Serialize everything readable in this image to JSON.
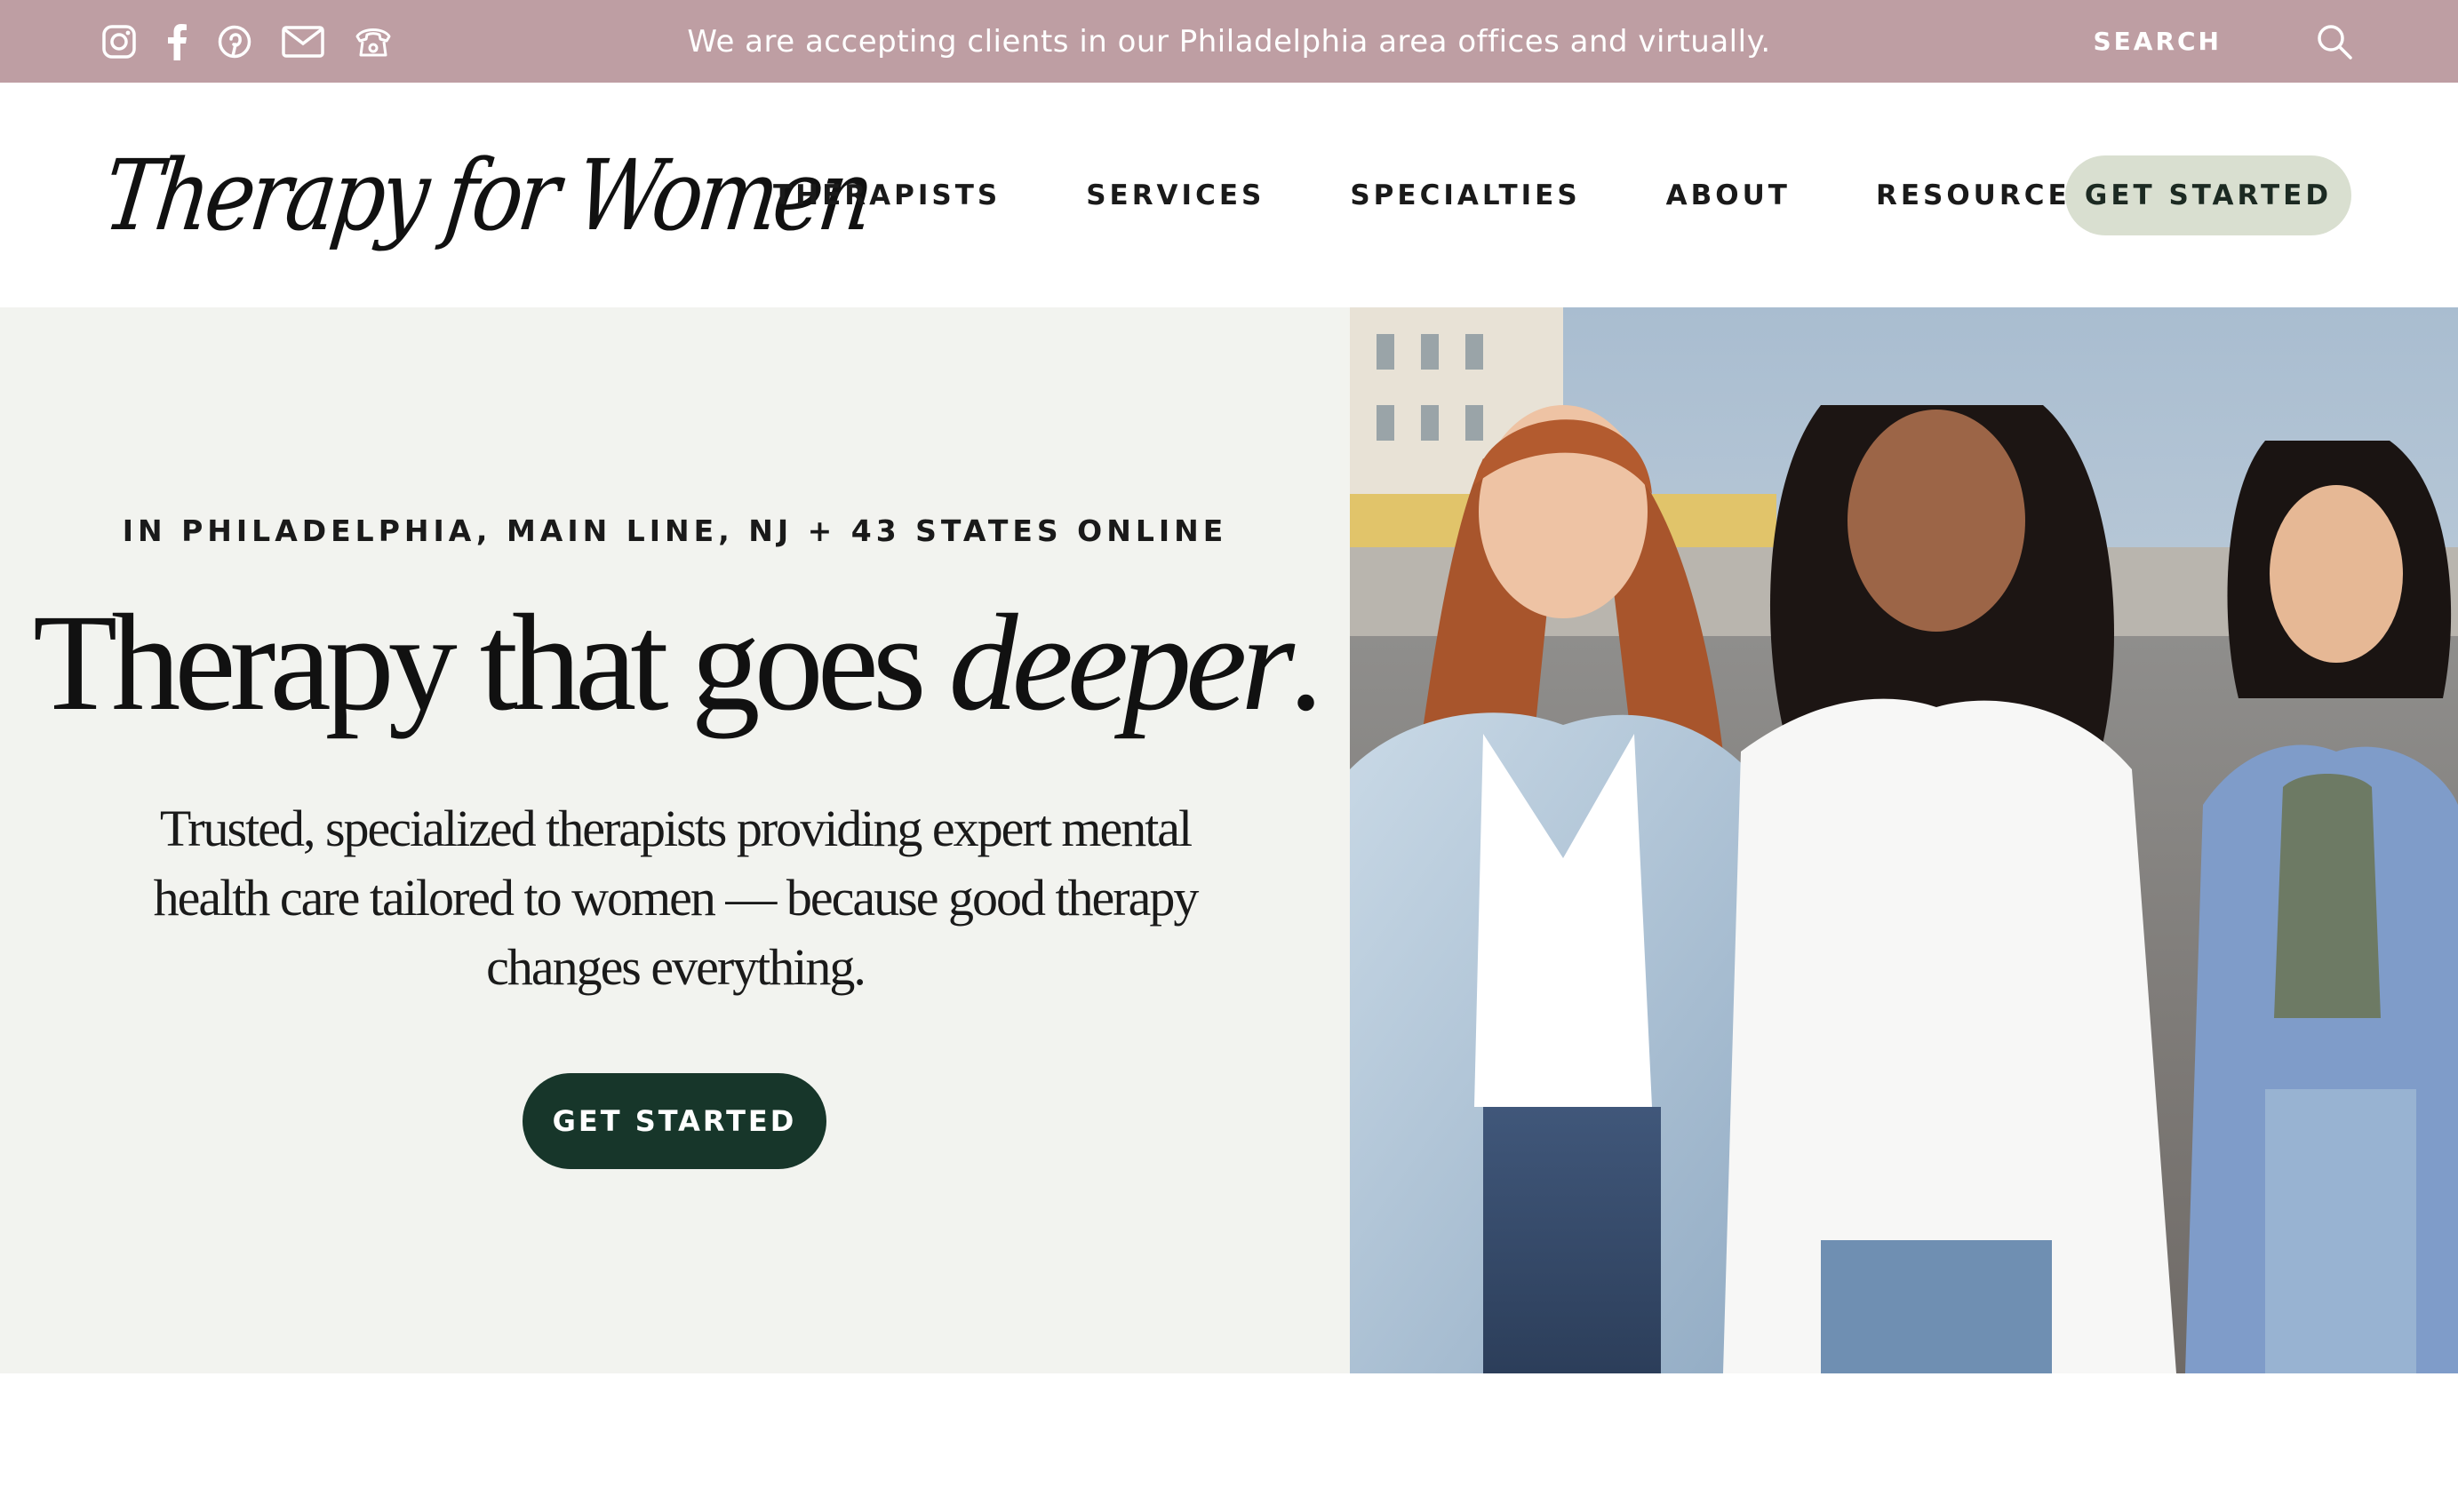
{
  "topbar": {
    "message": "We are accepting clients in our Philadelphia area offices and virtually.",
    "search_label": "SEARCH",
    "social_icons": [
      "instagram-icon",
      "facebook-icon",
      "pinterest-icon",
      "mail-icon",
      "phone-icon"
    ],
    "background": "#be9ea3"
  },
  "header": {
    "logo_text": "Therapy for Women",
    "nav": [
      "THERAPISTS",
      "SERVICES",
      "SPECIALTIES",
      "ABOUT",
      "RESOURCES"
    ],
    "cta_label": "GET STARTED",
    "cta_background": "#d9dfd0"
  },
  "hero": {
    "eyebrow": "IN PHILADELPHIA, MAIN LINE, NJ + 43 STATES ONLINE",
    "headline_main": "Therapy that goes ",
    "headline_emphasis": "deeper",
    "headline_end": ".",
    "subcopy": "Trusted, specialized therapists providing expert mental health care tailored to women — because good therapy changes everything.",
    "cta_label": "GET STARTED",
    "cta_background": "#17362a",
    "panel_background": "#f2f3ef"
  }
}
